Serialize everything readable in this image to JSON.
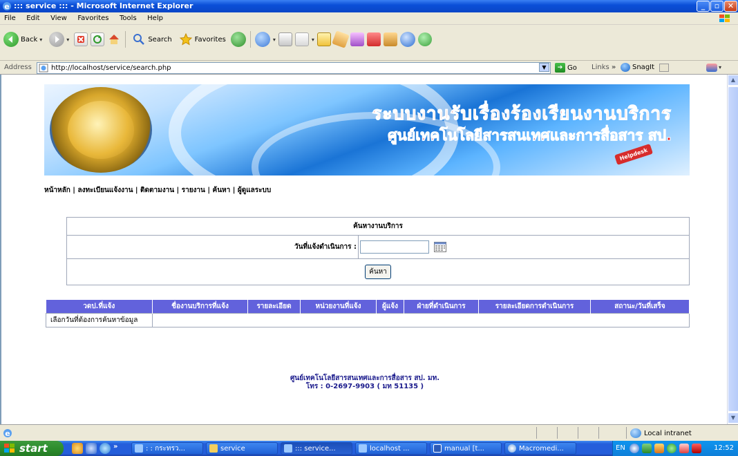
{
  "window": {
    "title": "::: service ::: - Microsoft Internet Explorer",
    "minimize": "_",
    "maximize": "▫",
    "close": "✕"
  },
  "menu": {
    "items": [
      "File",
      "Edit",
      "View",
      "Favorites",
      "Tools",
      "Help"
    ]
  },
  "toolbar": {
    "back_label": "Back",
    "search_label": "Search",
    "favorites_label": "Favorites"
  },
  "address": {
    "label": "Address",
    "url": "http://localhost/service/search.php",
    "go_label": "Go",
    "links_label": "Links",
    "links_chevron": "»",
    "snagit_label": "SnagIt"
  },
  "banner": {
    "heading1": "ระบบงานรับเรื่องร้องเรียนงานบริการ",
    "heading2": "ศูนย์เทคโนโลยีสารสนเทศและการสื่อสาร สป.",
    "helpdesk": "Helpdesk"
  },
  "nav": {
    "items": [
      "หน้าหลัก",
      "ลงทะเบียนแจ้งงาน",
      "ติดตามงาน",
      "รายงาน",
      "ค้นหา",
      "ผู้ดูแลระบบ"
    ],
    "separator": " | "
  },
  "search_form": {
    "title": "ค้นหางานบริการ",
    "date_label": "วันที่แจ้งดำเนินการ :",
    "date_value": "",
    "submit_label": "ค้นหา"
  },
  "results": {
    "columns": [
      "วดป.ที่แจ้ง",
      "ชื่องานบริการที่แจ้ง",
      "รายละเอียด",
      "หน่วยงานที่แจ้ง",
      "ผู้แจ้ง",
      "ฝ่ายที่ดำเนินการ",
      "รายละเอียดการดำเนินการ",
      "สถานะ/วันที่เสร็จ"
    ],
    "empty_message": "เลือกวันที่ต้องการค้นหาข้อมูล"
  },
  "footer": {
    "line1": "ศูนย์เทคโนโลยีสารสนเทศและการสื่อสาร สป. มท.",
    "line2": "โทร : 0-2697-9903  ( มท 51135 )"
  },
  "statusbar": {
    "zone": "Local intranet"
  },
  "taskbar": {
    "start_label": "start",
    "chevron": "»",
    "tasks": [
      {
        "label": ": : กระทรว..."
      },
      {
        "label": "service"
      },
      {
        "label": "::: service..."
      },
      {
        "label": "localhost ..."
      },
      {
        "label": "manual [t..."
      },
      {
        "label": "Macromedi..."
      }
    ],
    "lang": "EN",
    "clock": "12:52"
  },
  "colors": {
    "results_header_bg": "#6262dc",
    "footer_text": "#1a1a8c",
    "banner_heading": "#e11111"
  }
}
